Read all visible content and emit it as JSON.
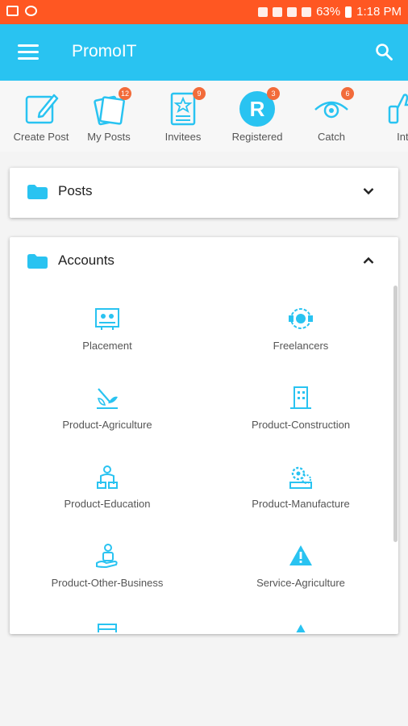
{
  "status_bar": {
    "battery": "63%",
    "time": "1:18 PM"
  },
  "app_bar": {
    "title": "PromoIT"
  },
  "quick_actions": [
    {
      "label": "Create Post",
      "icon": "create-post-icon",
      "badge": ""
    },
    {
      "label": "My Posts",
      "icon": "my-posts-icon",
      "badge": "12"
    },
    {
      "label": "Invitees",
      "icon": "invitees-icon",
      "badge": "9"
    },
    {
      "label": "Registered",
      "icon": "registered-icon",
      "badge": "3"
    },
    {
      "label": "Catch",
      "icon": "catch-icon",
      "badge": "6"
    },
    {
      "label": "Inte",
      "icon": "interest-icon",
      "badge": ""
    }
  ],
  "posts_section": {
    "title": "Posts",
    "expanded": false
  },
  "accounts_section": {
    "title": "Accounts",
    "expanded": true,
    "items": [
      {
        "label": "Placement",
        "icon": "placement-icon"
      },
      {
        "label": "Freelancers",
        "icon": "freelancers-icon"
      },
      {
        "label": "Product-Agriculture",
        "icon": "agriculture-icon"
      },
      {
        "label": "Product-Construction",
        "icon": "construction-icon"
      },
      {
        "label": "Product-Education",
        "icon": "education-icon"
      },
      {
        "label": "Product-Manufacture",
        "icon": "manufacture-icon"
      },
      {
        "label": "Product-Other-Business",
        "icon": "other-business-icon"
      },
      {
        "label": "Service-Agriculture",
        "icon": "warning-icon"
      }
    ]
  },
  "colors": {
    "accent": "#29c3f1",
    "status_bar": "#ff5722",
    "badge": "#f26b3a"
  }
}
